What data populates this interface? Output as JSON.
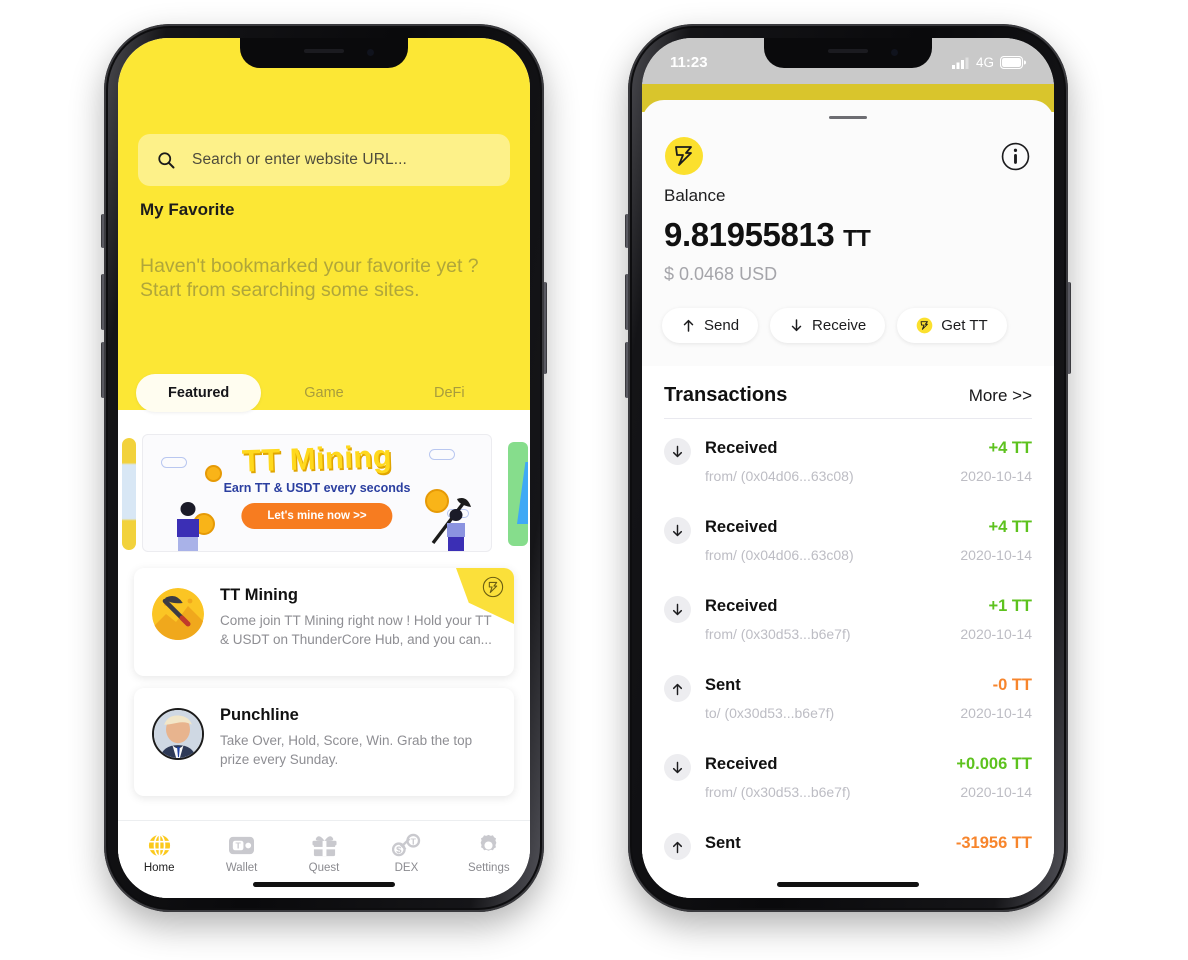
{
  "colors": {
    "brand_yellow": "#FCE735",
    "accent_orange": "#F77C20",
    "positive_green": "#5DC21E",
    "negative_orange": "#F7852C",
    "muted": "#BDBDC4"
  },
  "left_phone": {
    "name": "browser-home-screen",
    "search": {
      "placeholder": "Search or enter website URL...",
      "value": "",
      "icon": "search-icon"
    },
    "favorites": {
      "title": "My Favorite",
      "empty_line1": "Haven't bookmarked your favorite yet ?",
      "empty_line2": "Start from searching some sites."
    },
    "tabs": [
      {
        "label": "Featured",
        "active": true
      },
      {
        "label": "Game",
        "active": false
      },
      {
        "label": "DeFi",
        "active": false
      }
    ],
    "banner": {
      "title": "TT Mining",
      "subtitle": "Earn TT & USDT every seconds",
      "cta": "Let's mine now >>"
    },
    "app_cards": [
      {
        "name": "TT Mining",
        "description": "Come join TT Mining right now ! Hold your TT & USDT on ThunderCore Hub, and you can...",
        "icon": "pickaxe-icon",
        "ribbon": true
      },
      {
        "name": "Punchline",
        "description": "Take Over, Hold, Score, Win. Grab the top prize every Sunday.",
        "icon": "avatar-portrait",
        "ribbon": false
      }
    ],
    "tabbar": [
      {
        "label": "Home",
        "icon": "globe-icon",
        "active": true
      },
      {
        "label": "Wallet",
        "icon": "wallet-icon",
        "active": false
      },
      {
        "label": "Quest",
        "icon": "gift-icon",
        "active": false
      },
      {
        "label": "DEX",
        "icon": "swap-icon",
        "active": false
      },
      {
        "label": "Settings",
        "icon": "gear-icon",
        "active": false
      }
    ]
  },
  "right_phone": {
    "name": "wallet-screen",
    "status_bar": {
      "time": "11:23",
      "network": "4G",
      "signal_icon": "signal-bars-icon",
      "battery_icon": "battery-icon"
    },
    "wallet": {
      "logo_icon": "thundercore-logo-icon",
      "info_icon": "info-icon",
      "balance_label": "Balance",
      "balance_amount": "9.81955813",
      "balance_unit": "TT",
      "balance_fiat": "$ 0.0468 USD"
    },
    "actions": [
      {
        "label": "Send",
        "icon": "arrow-up-icon"
      },
      {
        "label": "Receive",
        "icon": "arrow-down-icon"
      },
      {
        "label": "Get TT",
        "icon": "tt-coin-icon"
      }
    ],
    "transactions_header": {
      "title": "Transactions",
      "more_label": "More >>"
    },
    "transactions": [
      {
        "type": "Received",
        "direction": "in",
        "address": "from/ (0x04d06...63c08)",
        "amount": "+4 TT",
        "date": "2020-10-14"
      },
      {
        "type": "Received",
        "direction": "in",
        "address": "from/ (0x04d06...63c08)",
        "amount": "+4 TT",
        "date": "2020-10-14"
      },
      {
        "type": "Received",
        "direction": "in",
        "address": "from/ (0x30d53...b6e7f)",
        "amount": "+1 TT",
        "date": "2020-10-14"
      },
      {
        "type": "Sent",
        "direction": "out",
        "address": "to/ (0x30d53...b6e7f)",
        "amount": "-0 TT",
        "date": "2020-10-14"
      },
      {
        "type": "Received",
        "direction": "in",
        "address": "from/ (0x30d53...b6e7f)",
        "amount": "+0.006 TT",
        "date": "2020-10-14"
      },
      {
        "type": "Sent",
        "direction": "out",
        "address": "",
        "amount": "-31956 TT",
        "date": ""
      }
    ]
  }
}
